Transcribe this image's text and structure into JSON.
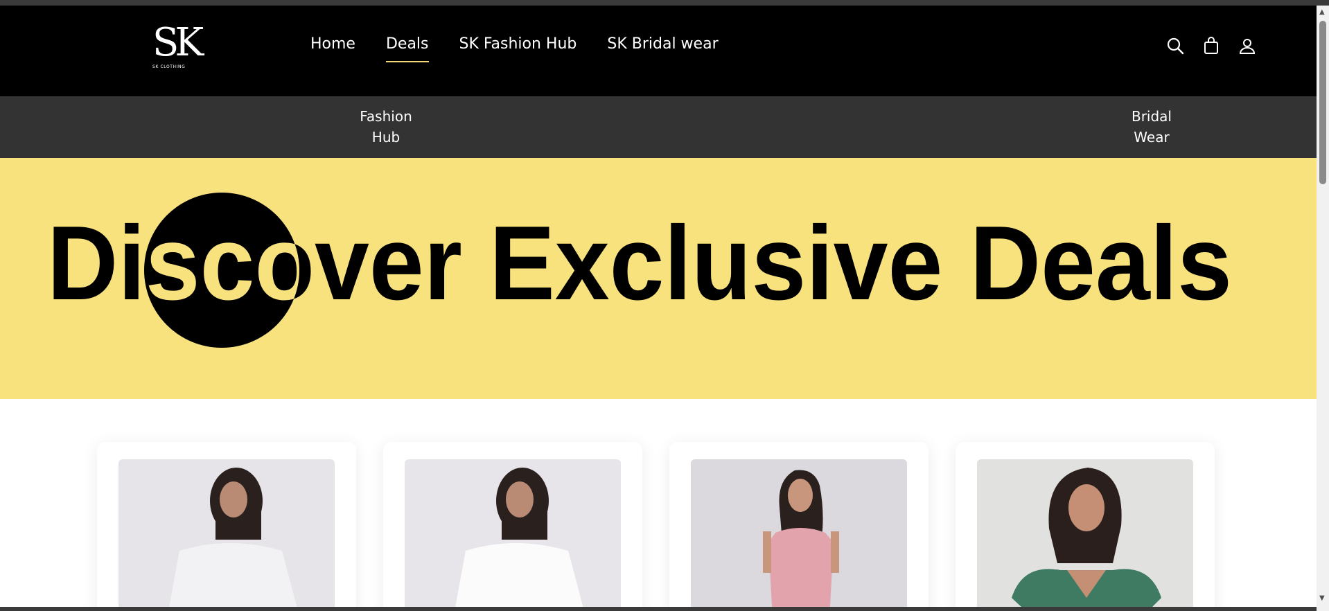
{
  "header": {
    "logo_text": "SK",
    "logo_sub": "SK CLOTHING",
    "nav": [
      {
        "label": "Home",
        "active": false
      },
      {
        "label": "Deals",
        "active": true
      },
      {
        "label": "SK Fashion Hub",
        "active": false
      },
      {
        "label": "SK Bridal wear",
        "active": false
      }
    ],
    "icons": [
      "search-icon",
      "shopping-bag-icon",
      "user-icon"
    ],
    "accent_color": "#f3d97a"
  },
  "subnav": {
    "items": [
      {
        "line1": "Fashion",
        "line2": "Hub"
      },
      {
        "line1": "Bridal",
        "line2": "Wear"
      }
    ]
  },
  "banner": {
    "headline": "Discover Exclusive Deals",
    "background": "#f8e27d"
  },
  "products": [
    {
      "image": "model-white-tshirt-back"
    },
    {
      "image": "model-white-tshirt-back"
    },
    {
      "image": "model-pink-halter-dress"
    },
    {
      "image": "model-green-floral-top"
    }
  ]
}
